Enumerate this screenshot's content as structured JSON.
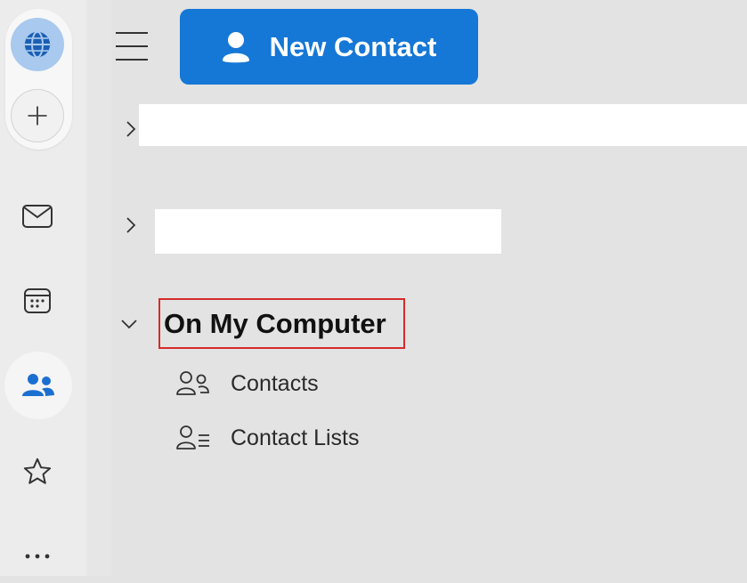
{
  "toolbar": {
    "new_contact_label": "New Contact"
  },
  "rail": {
    "items": [
      {
        "name": "mail-icon"
      },
      {
        "name": "calendar-icon"
      },
      {
        "name": "people-icon",
        "active": true
      },
      {
        "name": "star-icon"
      },
      {
        "name": "more-icon",
        "label": "..."
      }
    ]
  },
  "tree": {
    "section_title": "On My Computer",
    "items": [
      {
        "label": "Contacts",
        "icon": "contacts-icon"
      },
      {
        "label": "Contact Lists",
        "icon": "contact-lists-icon"
      }
    ]
  },
  "colors": {
    "accent": "#1577d6",
    "highlight_border": "#d62b2b",
    "rail_active_icon": "#1b6fd1"
  }
}
